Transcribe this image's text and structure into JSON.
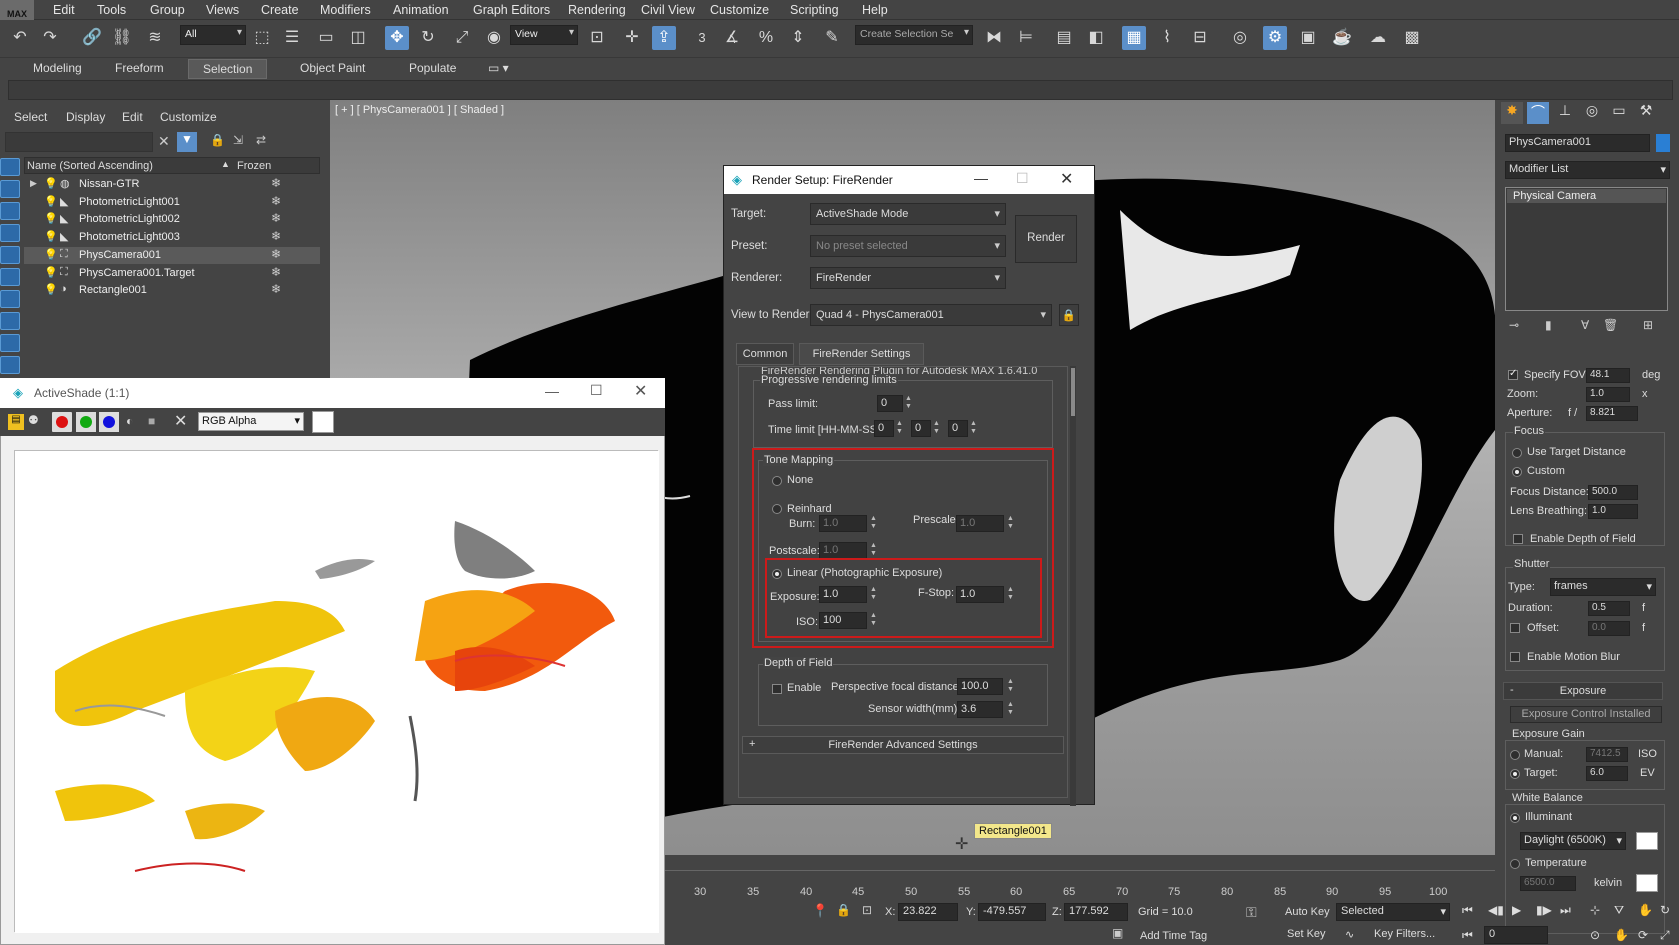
{
  "app": {
    "logo": "MAX"
  },
  "menu": [
    "Edit",
    "Tools",
    "Group",
    "Views",
    "Create",
    "Modifiers",
    "Animation",
    "Graph Editors",
    "Rendering",
    "Civil View",
    "Customize",
    "Scripting",
    "Help"
  ],
  "toolbar": {
    "filter_value": "All",
    "ref_coord_value": "View",
    "selection_set_placeholder": "Create Selection Se",
    "snap_label": "3",
    "icons": [
      "undo-icon",
      "redo-icon",
      "link-icon",
      "unlink-icon",
      "bind-space-warp-icon",
      "select-icon",
      "select-by-name-icon",
      "rect-region-icon",
      "window-crossing-icon",
      "move-icon",
      "rotate-icon",
      "scale-icon",
      "placement-icon",
      "pivot-icon",
      "snap-icon",
      "angle-snap-icon",
      "percent-snap-icon",
      "spinner-snap-icon",
      "edit-named-sets-icon",
      "mirror-icon",
      "align-icon",
      "layer-icon",
      "scene-explorer-icon",
      "curve-editor-icon",
      "schematic-icon",
      "material-editor-icon",
      "render-setup-icon",
      "rendered-frame-icon",
      "render-icon",
      "render-cloud-icon",
      "a360-icon"
    ]
  },
  "ribbon": {
    "tabs": [
      "Modeling",
      "Freeform",
      "Selection",
      "Object Paint",
      "Populate"
    ],
    "active": "Selection"
  },
  "scene_explorer": {
    "menus": [
      "Select",
      "Display",
      "Edit",
      "Customize"
    ],
    "col_name": "Name (Sorted Ascending)",
    "col_frozen": "Frozen",
    "rows": [
      {
        "name": "Nissan-GTR",
        "selected": false
      },
      {
        "name": "PhotometricLight001",
        "selected": false
      },
      {
        "name": "PhotometricLight002",
        "selected": false
      },
      {
        "name": "PhotometricLight003",
        "selected": false
      },
      {
        "name": "PhysCamera001",
        "selected": true
      },
      {
        "name": "PhysCamera001.Target",
        "selected": false
      },
      {
        "name": "Rectangle001",
        "selected": false
      }
    ]
  },
  "viewport": {
    "label": "[ + ] [ PhysCamera001 ] [ Shaded ]",
    "tooltip": "Rectangle001"
  },
  "activeshade": {
    "title": "ActiveShade (1:1)",
    "channel": "RGB Alpha"
  },
  "render_setup": {
    "title": "Render Setup: FireRender",
    "target_label": "Target:",
    "target_value": "ActiveShade Mode",
    "preset_label": "Preset:",
    "preset_value": "No preset selected",
    "renderer_label": "Renderer:",
    "renderer_value": "FireRender",
    "view_label": "View to Render:",
    "view_value": "Quad 4 - PhysCamera001",
    "render_button": "Render",
    "tabs": [
      "Common",
      "FireRender Settings"
    ],
    "plugin_line": "FireRender Rendering Plugin for Autodesk MAX 1.6.41.0",
    "prog": {
      "title": "Progressive rendering limits",
      "pass_label": "Pass limit:",
      "pass_value": "0",
      "time_label": "Time limit [HH-MM-SS]:",
      "hh": "0",
      "mm": "0",
      "ss": "0"
    },
    "tone": {
      "title": "Tone Mapping",
      "none": "None",
      "reinhard": "Reinhard",
      "burn_label": "Burn:",
      "burn_value": "1.0",
      "prescale_label": "Prescale:",
      "prescale_value": "1.0",
      "postscale_label": "Postscale:",
      "postscale_value": "1.0",
      "linear": "Linear (Photographic Exposure)",
      "exposure_label": "Exposure:",
      "exposure_value": "1.0",
      "fstop_label": "F-Stop:",
      "fstop_value": "1.0",
      "iso_label": "ISO:",
      "iso_value": "100"
    },
    "dof": {
      "title": "Depth of Field",
      "enable": "Enable",
      "focal_label": "Perspective focal distance:",
      "focal_value": "100.0",
      "sensor_label": "Sensor width(mm):",
      "sensor_value": "3.6"
    },
    "advanced": "FireRender Advanced Settings",
    "advanced_plus": "+"
  },
  "modify_panel": {
    "object_name": "PhysCamera001",
    "modifier_list": "Modifier List",
    "stack_item": "Physical Camera",
    "fov_label": "Specify FOV:",
    "fov_value": "48.1",
    "fov_unit": "deg",
    "zoom_label": "Zoom:",
    "zoom_value": "1.0",
    "zoom_unit": "x",
    "aperture_label": "Aperture:",
    "aperture_prefix": "f /",
    "aperture_value": "8.821",
    "focus_title": "Focus",
    "use_target": "Use Target Distance",
    "custom": "Custom",
    "focus_dist_label": "Focus Distance:",
    "focus_dist_value": "500.0",
    "lens_label": "Lens Breathing:",
    "lens_value": "1.0",
    "dof_enable": "Enable Depth of Field",
    "shutter_title": "Shutter",
    "type_label": "Type:",
    "type_value": "frames",
    "duration_label": "Duration:",
    "duration_value": "0.5",
    "duration_unit": "f",
    "offset_label": "Offset:",
    "offset_value": "0.0",
    "offset_unit": "f",
    "motion_blur": "Enable Motion Blur",
    "exposure_rollout": "Exposure",
    "exposure_rollout_sign": "-",
    "exposure_control": "Exposure Control Installed",
    "gain_title": "Exposure Gain",
    "manual_label": "Manual:",
    "manual_value": "7412.5",
    "manual_unit": "ISO",
    "target_label": "Target:",
    "target_value": "6.0",
    "target_unit": "EV",
    "wb_title": "White Balance",
    "illuminant": "Illuminant",
    "illuminant_value": "Daylight (6500K)",
    "temperature": "Temperature",
    "kelvin_value": "6500.0",
    "kelvin_unit": "kelvin"
  },
  "timeline": {
    "ticks": [
      "30",
      "35",
      "40",
      "45",
      "50",
      "55",
      "60",
      "65",
      "70",
      "75",
      "80",
      "85",
      "90",
      "95",
      "100"
    ]
  },
  "status": {
    "x_label": "X:",
    "x_value": "23.822",
    "y_label": "Y:",
    "y_value": "-479.557",
    "z_label": "Z:",
    "z_value": "177.592",
    "grid": "Grid = 10.0",
    "auto_key": "Auto Key",
    "set_key": "Set Key",
    "selected": "Selected",
    "key_filters": "Key Filters...",
    "add_time_tag": "Add Time Tag",
    "frame_value": "0"
  }
}
